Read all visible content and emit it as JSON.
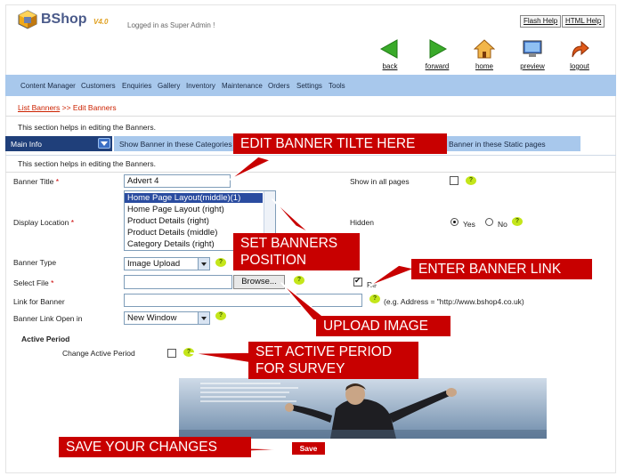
{
  "header": {
    "logo_text": "BShop",
    "version": "V4.0",
    "logged_in": "Logged in as Super Admin !",
    "flash_help": "Flash Help",
    "html_help": "HTML Help"
  },
  "toolbar": {
    "back": "back",
    "forward": "forward",
    "home": "home",
    "preview": "preview",
    "logout": "logout"
  },
  "menu": [
    "Content Manager",
    "Customers",
    "Enquiries",
    "Gallery",
    "Inventory",
    "Maintenance",
    "Orders",
    "Settings",
    "Tools"
  ],
  "breadcrumb": {
    "link": "List Banners",
    "sep": " >> ",
    "current": "Edit Banners"
  },
  "section_help": "This section helps in editing the Banners.",
  "tabs": {
    "main": "Main Info",
    "show_categories": "Show Banner in these Categories",
    "show_static": "Banner in these Static pages"
  },
  "form": {
    "help": "This section helps in editing the Banners.",
    "banner_title_label": "Banner Title",
    "banner_title_value": "Advert 4",
    "show_all_pages_label": "Show in all pages",
    "display_location_label": "Display Location",
    "locations": [
      "Home Page Layout(middle)(1)",
      "Home Page Layout (right)",
      "Product Details (right)",
      "Product Details (middle)",
      "Category Details (right)"
    ],
    "hidden_label": "Hidden",
    "yes": "Yes",
    "no": "No",
    "banner_type_label": "Banner Type",
    "banner_type_value": "Image Upload",
    "select_file_label": "Select File",
    "browse": "Browse...",
    "re_label": "Re",
    "link_label": "Link for Banner",
    "link_hint": "(e.g. Address = \"http://www.bshop4.co.uk)",
    "open_in_label": "Banner Link Open in",
    "open_in_value": "New Window",
    "active_period_heading": "Active Period",
    "change_active_label": "Change Active Period",
    "required_mark": "*",
    "help_mark": "?",
    "save": "Save"
  },
  "callouts": {
    "edit_title": "EDIT BANNER TILTE HERE",
    "set_position_1": "SET BANNERS",
    "set_position_2": "POSITION",
    "enter_link": "ENTER BANNER LINK",
    "upload_image": "UPLOAD IMAGE",
    "active_period_1": "SET ACTIVE PERIOD",
    "active_period_2": "FOR SURVEY",
    "save_changes": "SAVE YOUR CHANGES"
  },
  "colors": {
    "accent_red": "#c80000",
    "menu_blue": "#a8c8ec",
    "tab_dark": "#1f3f7a"
  }
}
